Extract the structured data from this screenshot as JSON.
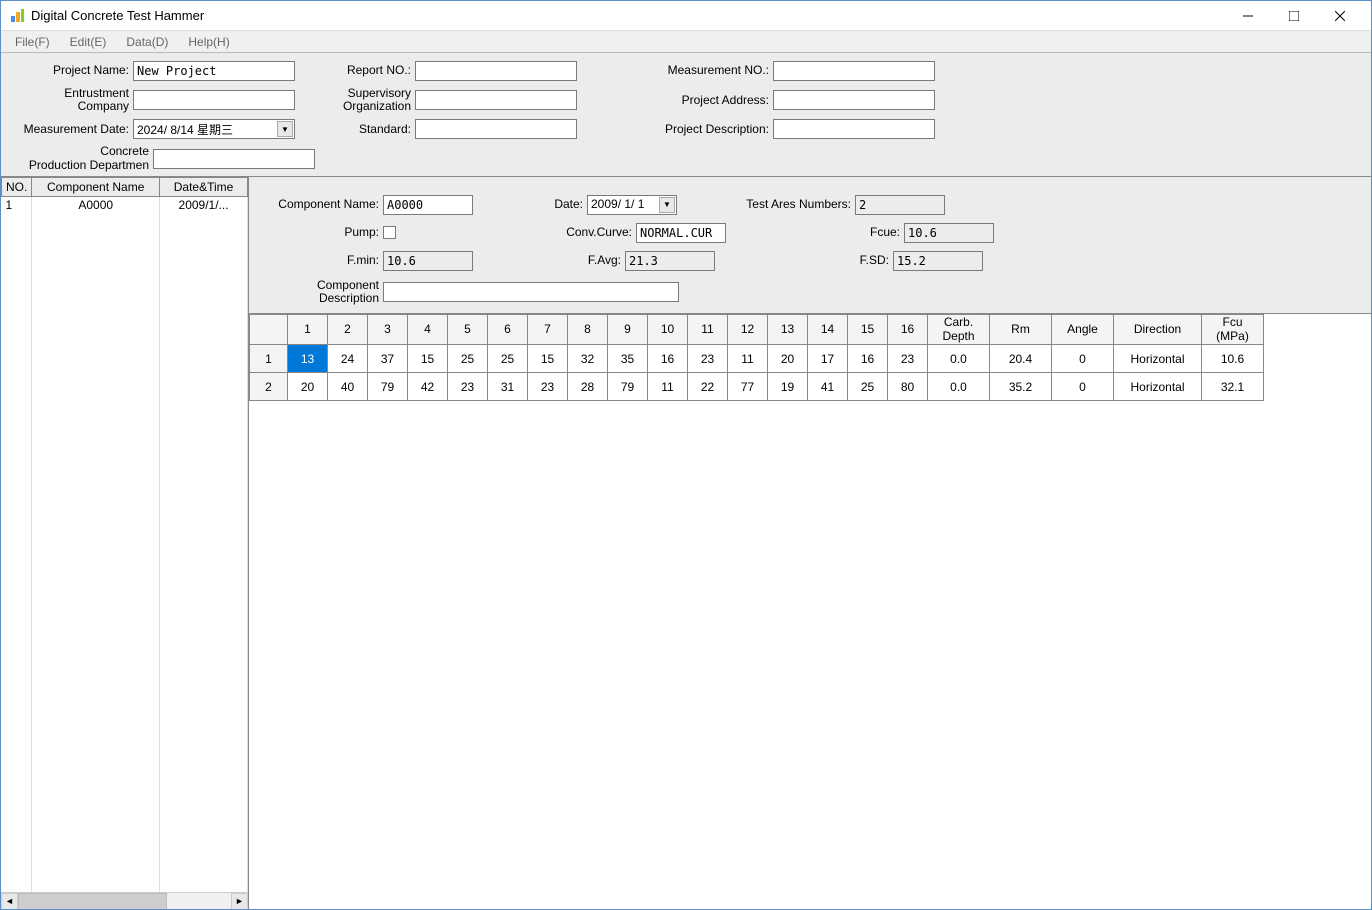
{
  "window": {
    "title": "Digital  Concrete Test Hammer"
  },
  "menu": {
    "file": "File(F)",
    "edit": "Edit(E)",
    "data": "Data(D)",
    "help": "Help(H)"
  },
  "topForm": {
    "projectName": {
      "label": "Project Name:",
      "value": "New Project"
    },
    "reportNo": {
      "label": "Report NO.:",
      "value": ""
    },
    "measurementNo": {
      "label": "Measurement NO.:",
      "value": ""
    },
    "entrustmentCompany": {
      "label": "Entrustment\nCompany",
      "value": ""
    },
    "supervisoryOrg": {
      "label": "Supervisory\nOrganization",
      "value": ""
    },
    "projectAddress": {
      "label": "Project Address:",
      "value": ""
    },
    "measurementDate": {
      "label": "Measurement Date:",
      "value": "2024/ 8/14 星期三"
    },
    "standard": {
      "label": "Standard:",
      "value": ""
    },
    "projectDescription": {
      "label": "Project Description:",
      "value": ""
    },
    "concreteDept": {
      "label": "Concrete\nProduction Departmen",
      "value": ""
    }
  },
  "listTable": {
    "headers": {
      "no": "NO.",
      "name": "Component Name",
      "dt": "Date&Time"
    },
    "rows": [
      {
        "no": "1",
        "name": "A0000",
        "dt": "2009/1/..."
      }
    ]
  },
  "componentForm": {
    "name": {
      "label": "Component Name:",
      "value": "A0000"
    },
    "date": {
      "label": "Date:",
      "value": "2009/ 1/ 1"
    },
    "testAreas": {
      "label": "Test Ares Numbers:",
      "value": "2"
    },
    "pump": {
      "label": "Pump:"
    },
    "convCurve": {
      "label": "Conv.Curve:",
      "value": "NORMAL.CUR"
    },
    "fcue": {
      "label": "Fcue:",
      "value": "10.6"
    },
    "fmin": {
      "label": "F.min:",
      "value": "10.6"
    },
    "favg": {
      "label": "F.Avg:",
      "value": "21.3"
    },
    "fsd": {
      "label": "F.SD:",
      "value": "15.2"
    },
    "desc": {
      "label": "Component\nDescription",
      "value": ""
    }
  },
  "dataTable": {
    "headers": [
      "",
      "1",
      "2",
      "3",
      "4",
      "5",
      "6",
      "7",
      "8",
      "9",
      "10",
      "11",
      "12",
      "13",
      "14",
      "15",
      "16",
      "Carb.\nDepth",
      "Rm",
      "Angle",
      "Direction",
      "Fcu\n(MPa)"
    ],
    "rows": [
      {
        "rowHeader": "1",
        "cells": [
          "13",
          "24",
          "37",
          "15",
          "25",
          "25",
          "15",
          "32",
          "35",
          "16",
          "23",
          "11",
          "20",
          "17",
          "16",
          "23",
          "0.0",
          "20.4",
          "0",
          "Horizontal",
          "10.6"
        ],
        "selectedIndex": 0
      },
      {
        "rowHeader": "2",
        "cells": [
          "20",
          "40",
          "79",
          "42",
          "23",
          "31",
          "23",
          "28",
          "79",
          "11",
          "22",
          "77",
          "19",
          "41",
          "25",
          "80",
          "0.0",
          "35.2",
          "0",
          "Horizontal",
          "32.1"
        ]
      }
    ]
  }
}
